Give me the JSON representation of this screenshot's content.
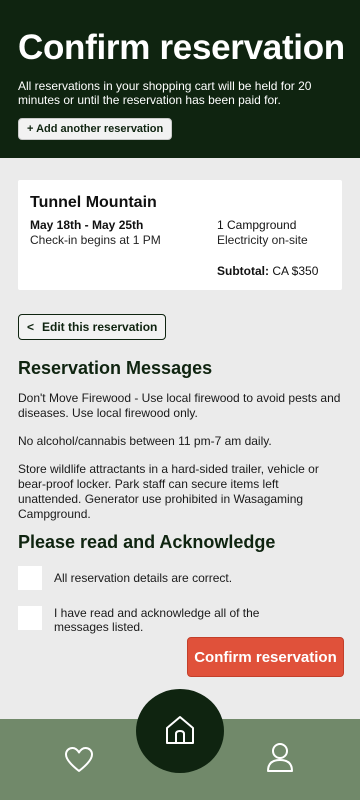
{
  "header": {
    "title": "Confirm reservation",
    "hold_note": "All reservations in your shopping cart will be held for 20 minutes or until the reservation has been paid for.",
    "add_button": "+ Add another reservation"
  },
  "reservation": {
    "park": "Tunnel Mountain",
    "dates": "May 18th - May 25th",
    "checkin": "Check-in begins at 1 PM",
    "site": "1 Campground",
    "amenity": "Electricity on-site",
    "subtotal_label": "Subtotal:",
    "subtotal_value": "CA $350"
  },
  "edit_button": {
    "chevron": "<",
    "label": "Edit this reservation"
  },
  "messages": {
    "title": "Reservation Messages",
    "items": [
      "Don't Move Firewood - Use local firewood to avoid pests and diseases. Use local firewood only.",
      "No alcohol/cannabis between 11 pm-7 am daily.",
      "Store wildlife attractants in a hard-sided trailer, vehicle or bear-proof locker. Park staff can secure items left unattended. Generator use prohibited in Wasagaming Campground."
    ]
  },
  "acknowledge": {
    "title": "Please read and Acknowledge",
    "items": [
      "All reservation details are correct.",
      "I have read and acknowledge all of the messages listed."
    ]
  },
  "confirm_button": "Confirm reservation",
  "nav": {
    "icons": [
      "heart-icon",
      "home-icon",
      "user-icon"
    ]
  },
  "colors": {
    "header_bg": "#0f2410",
    "accent": "#e0513a",
    "nav_bg": "#71896a",
    "page_bg": "#ebebeb"
  }
}
